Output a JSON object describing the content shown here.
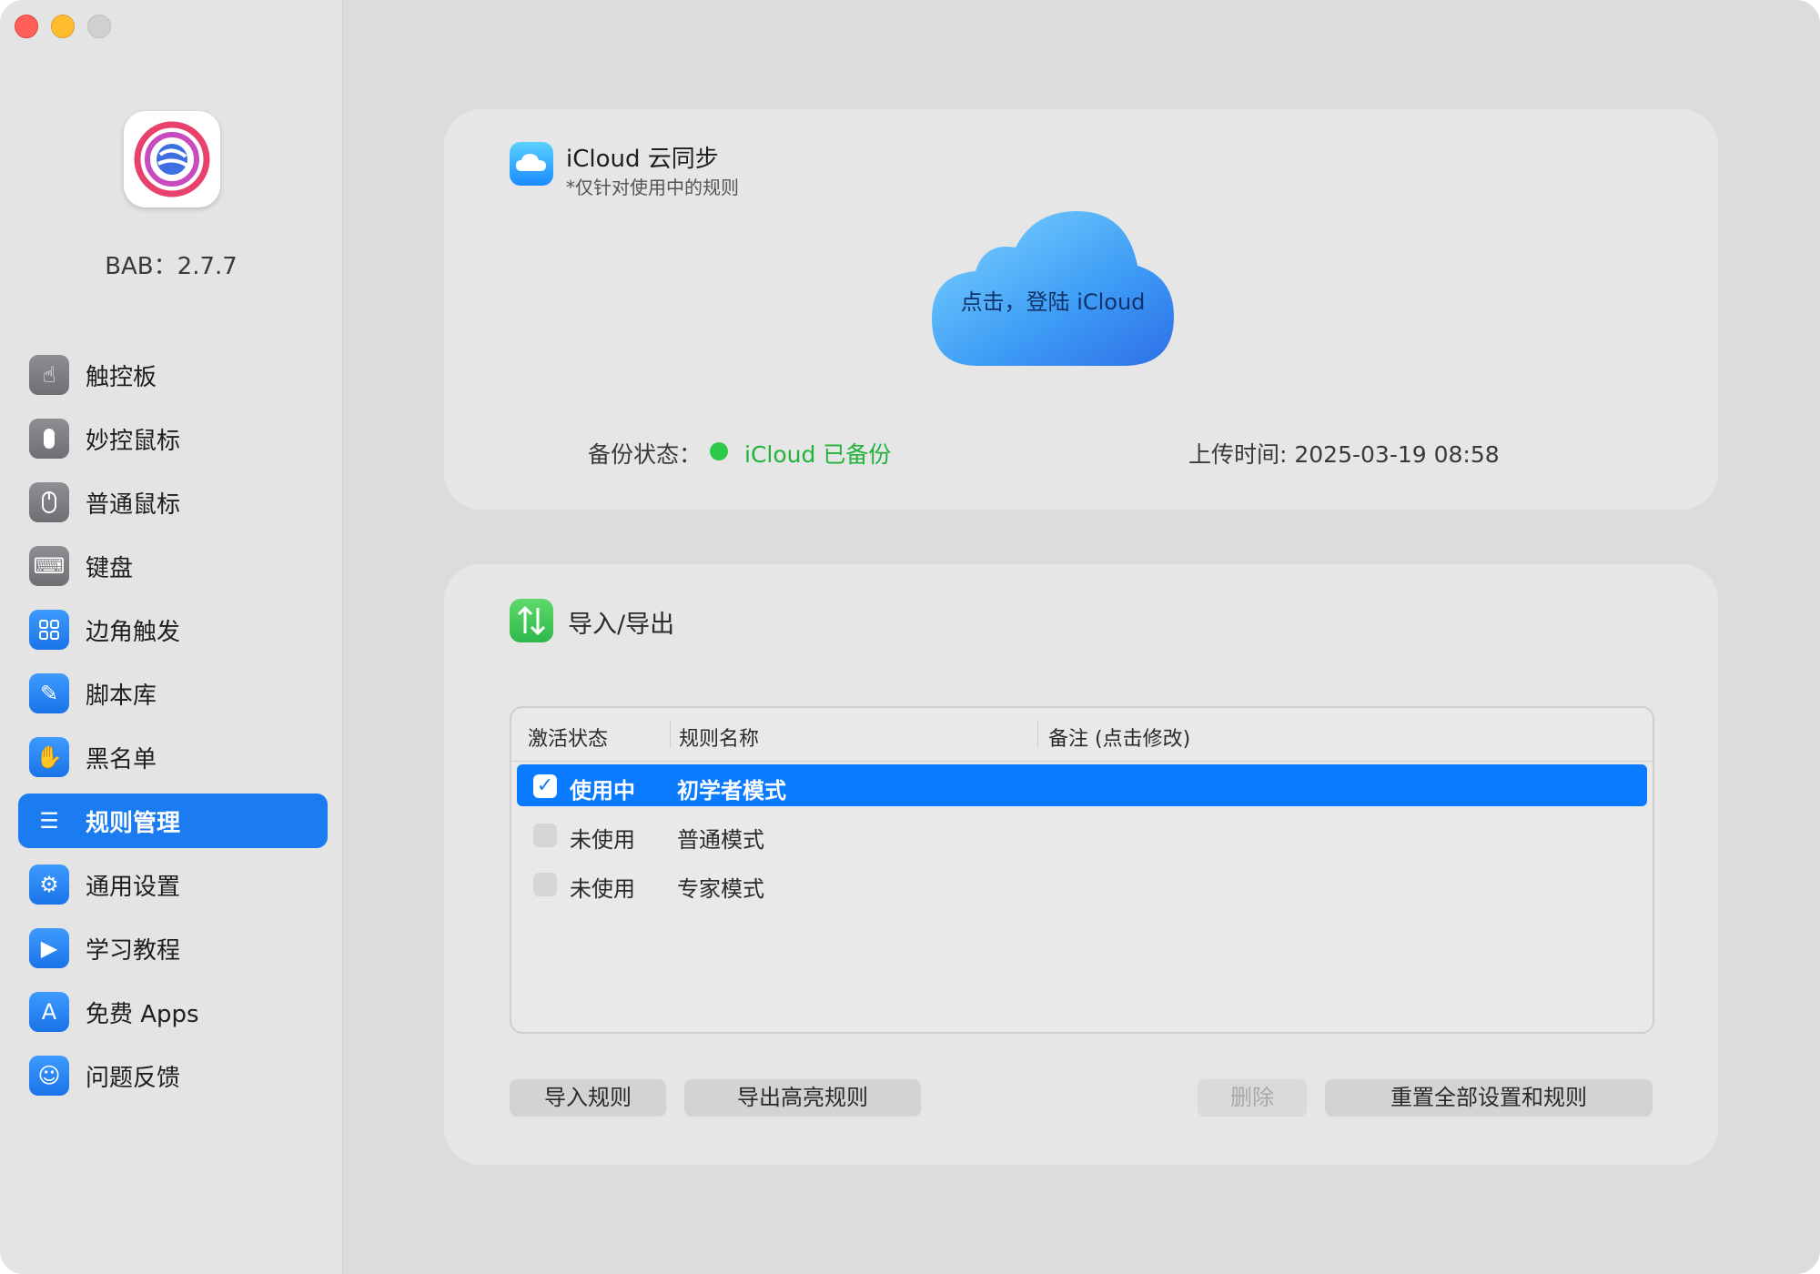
{
  "window": {
    "version_label": "BAB：2.7.7"
  },
  "sidebar": {
    "items": [
      {
        "label": "触控板",
        "icon": "touchpad-icon",
        "active": false
      },
      {
        "label": "妙控鼠标",
        "icon": "magic-mouse-icon",
        "active": false
      },
      {
        "label": "普通鼠标",
        "icon": "mouse-icon",
        "active": false
      },
      {
        "label": "键盘",
        "icon": "keyboard-icon",
        "active": false
      },
      {
        "label": "边角触发",
        "icon": "hot-corners-icon",
        "active": false
      },
      {
        "label": "脚本库",
        "icon": "script-library-icon",
        "active": false
      },
      {
        "label": "黑名单",
        "icon": "hand-icon",
        "active": false
      },
      {
        "label": "规则管理",
        "icon": "list-icon",
        "active": true
      },
      {
        "label": "通用设置",
        "icon": "gear-icon",
        "active": false
      },
      {
        "label": "学习教程",
        "icon": "video-icon",
        "active": false
      },
      {
        "label": "免费 Apps",
        "icon": "app-store-icon",
        "active": false
      },
      {
        "label": "问题反馈",
        "icon": "people-icon",
        "active": false
      }
    ]
  },
  "icloud": {
    "title": "iCloud 云同步",
    "subtitle": "*仅针对使用中的规则",
    "login_label": "点击，登陆 iCloud",
    "status_label": "备份状态：",
    "status_value": "iCloud 已备份",
    "upload_time": "上传时间: 2025-03-19  08:58"
  },
  "import_export": {
    "title": "导入/导出",
    "table": {
      "columns": [
        "激活状态",
        "规则名称",
        "备注 (点击修改)"
      ],
      "rows": [
        {
          "checked": true,
          "status": "使用中",
          "name": "初学者模式",
          "note": ""
        },
        {
          "checked": false,
          "status": "未使用",
          "name": "普通模式",
          "note": ""
        },
        {
          "checked": false,
          "status": "未使用",
          "name": "专家模式",
          "note": ""
        }
      ]
    },
    "buttons": {
      "import": "导入规则",
      "export": "导出高亮规则",
      "delete": "删除",
      "reset": "重置全部设置和规则"
    }
  },
  "colors": {
    "accent": "#1a7cf0",
    "selected_row": "#0a7aff",
    "status_green": "#2ec84a"
  }
}
